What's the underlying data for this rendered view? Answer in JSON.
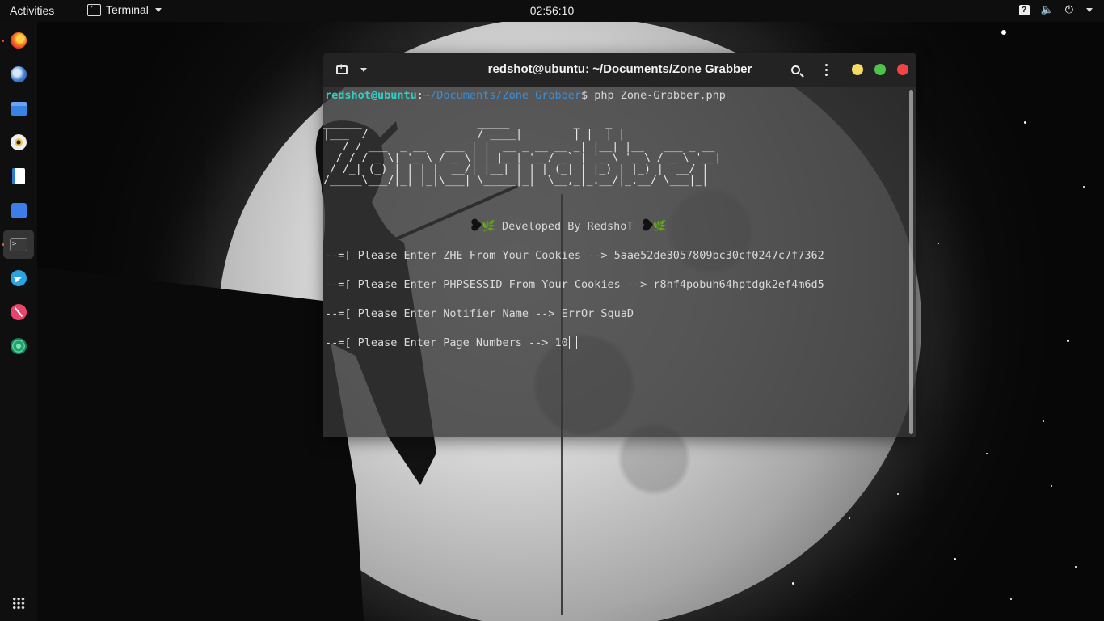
{
  "topbar": {
    "activities": "Activities",
    "app_name": "Terminal",
    "clock": "02:56:10",
    "icons": [
      "help-icon",
      "volume-icon",
      "power-icon",
      "chevron-down-icon"
    ]
  },
  "dock": {
    "apps": [
      "Firefox",
      "Thunderbird",
      "Files",
      "Rhythmbox",
      "LibreOffice Writer",
      "Ubuntu Software",
      "Terminal",
      "Telegram",
      "Postman",
      "VPN"
    ],
    "active": "Terminal"
  },
  "terminal": {
    "title": "redshot@ubuntu: ~/Documents/Zone Grabber",
    "prompt_user": "redshot@ubuntu",
    "prompt_sep": ":",
    "prompt_path": "~/Documents/Zone Grabber",
    "prompt_symbol": "$",
    "command": " php Zone-Grabber.php",
    "banner": "______                  _____          _    _     \n|___  /                 / ____|        | |  | |    \n   / / ___  _ __   ___ | |  __ _ __ __ _| |__| |__   ___ _ __ \n  / / / _ \\| '_ \\ / _ \\| | |_ | '__/ _` | '_ \\ '_ \\ / _ \\ '__|\n / /_| (_) | | | |  __/| |__| | | | (_| | |_) | |_) |  __/ |   \n/_____\\___/|_| |_|\\___| \\_____|_|  \\__,_|_.__/|_.__/ \\___|_|   ",
    "developed_by": " Developed By RedshoT ",
    "lines": [
      {
        "prompt": "--=[ Please Enter ZHE From Your Cookies --> ",
        "value": "5aae52de3057809bc30cf0247c7f7362"
      },
      {
        "prompt": "--=[ Please Enter PHPSESSID From Your Cookies --> ",
        "value": "r8hf4pobuh64hptdgk2ef4m6d5"
      },
      {
        "prompt": "--=[ Please Enter Notifier Name --> ",
        "value": "ErrOr SquaD"
      },
      {
        "prompt": "--=[ Please Enter Page Numbers --> ",
        "value": "10"
      }
    ]
  },
  "colors": {
    "prompt_user": "#2fd1c4",
    "prompt_path": "#3b8ed8",
    "close": "#ef4545",
    "minimize": "#f4dd5e",
    "maximize": "#4dc34c"
  }
}
